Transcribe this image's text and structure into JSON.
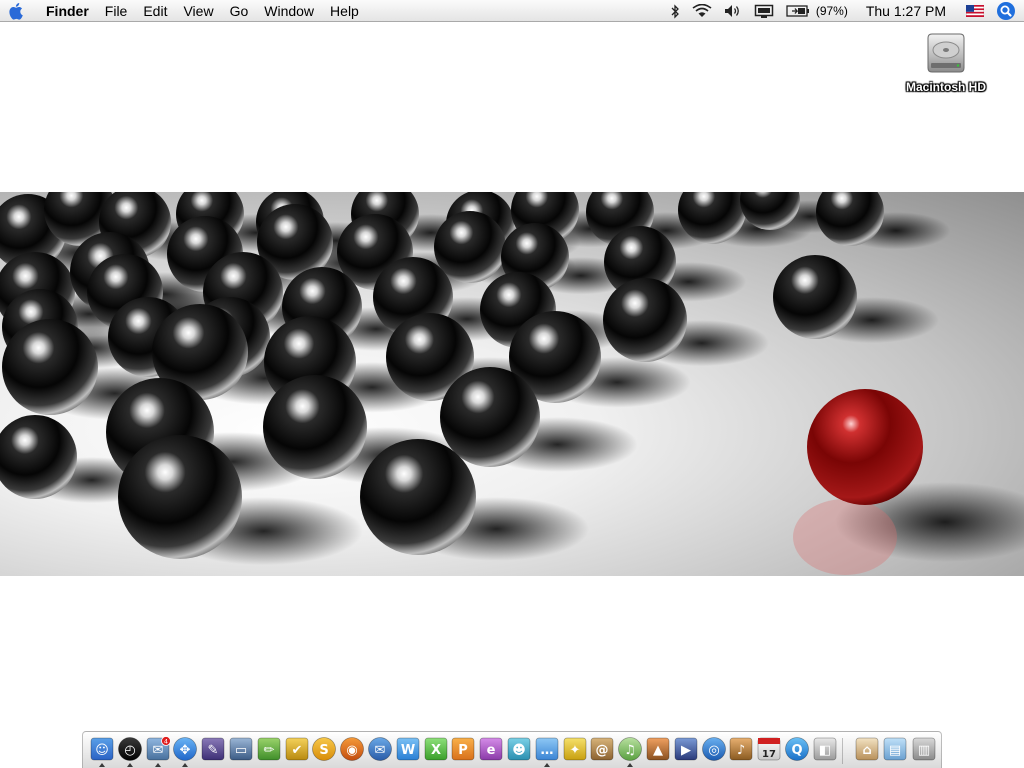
{
  "menubar": {
    "apple_icon": "apple-icon",
    "app_name": "Finder",
    "menus": [
      "File",
      "Edit",
      "View",
      "Go",
      "Window",
      "Help"
    ],
    "status": {
      "bluetooth_icon": "bluetooth-icon",
      "wifi_icon": "wifi-icon",
      "volume_icon": "volume-icon",
      "display_icon": "display-icon",
      "battery_icon": "battery-icon",
      "battery_text": "(97%)",
      "clock": "Thu 1:27 PM",
      "input_menu_icon": "us-flag-icon",
      "spotlight_icon": "spotlight-icon"
    }
  },
  "desktop": {
    "icons": [
      {
        "label": "Macintosh HD",
        "icon": "hard-drive-icon"
      }
    ]
  },
  "dock": {
    "apps": [
      {
        "icon": "finder-icon",
        "running": true
      },
      {
        "icon": "dashboard-icon",
        "running": true
      },
      {
        "icon": "mail-icon",
        "running": true,
        "badge": "4"
      },
      {
        "icon": "safari-icon",
        "running": true
      },
      {
        "icon": "script-editor-icon",
        "running": false
      },
      {
        "icon": "keynote-icon",
        "running": false
      },
      {
        "icon": "pencil-icon",
        "running": false
      },
      {
        "icon": "checkmark-icon",
        "running": false
      },
      {
        "icon": "skype-icon",
        "running": false
      },
      {
        "icon": "firefox-icon",
        "running": false
      },
      {
        "icon": "thunderbird-icon",
        "running": false
      },
      {
        "icon": "word-icon",
        "running": false
      },
      {
        "icon": "excel-icon",
        "running": false
      },
      {
        "icon": "powerpoint-icon",
        "running": false
      },
      {
        "icon": "entourage-icon",
        "running": false
      },
      {
        "icon": "messenger-icon",
        "running": false
      },
      {
        "icon": "ichat-icon",
        "running": true
      },
      {
        "icon": "aim-icon",
        "running": false
      },
      {
        "icon": "address-book-icon",
        "running": false
      },
      {
        "icon": "itunes-icon",
        "running": true
      },
      {
        "icon": "iphoto-icon",
        "running": false
      },
      {
        "icon": "imovie-icon",
        "running": false
      },
      {
        "icon": "idvd-icon",
        "running": false
      },
      {
        "icon": "garageband-icon",
        "running": false
      },
      {
        "icon": "ical-icon",
        "running": false,
        "text": "17"
      },
      {
        "icon": "quicktime-icon",
        "running": false
      },
      {
        "icon": "preview-icon",
        "running": false
      }
    ],
    "right": [
      {
        "icon": "home-folder-icon"
      },
      {
        "icon": "applications-folder-icon"
      },
      {
        "icon": "trash-icon"
      }
    ]
  },
  "colors": {
    "menubar_bg": "#eeeeee",
    "apple_blue": "#2a6ad8",
    "desktop_bg": "#ffffff",
    "red_sphere": "#b01515"
  }
}
